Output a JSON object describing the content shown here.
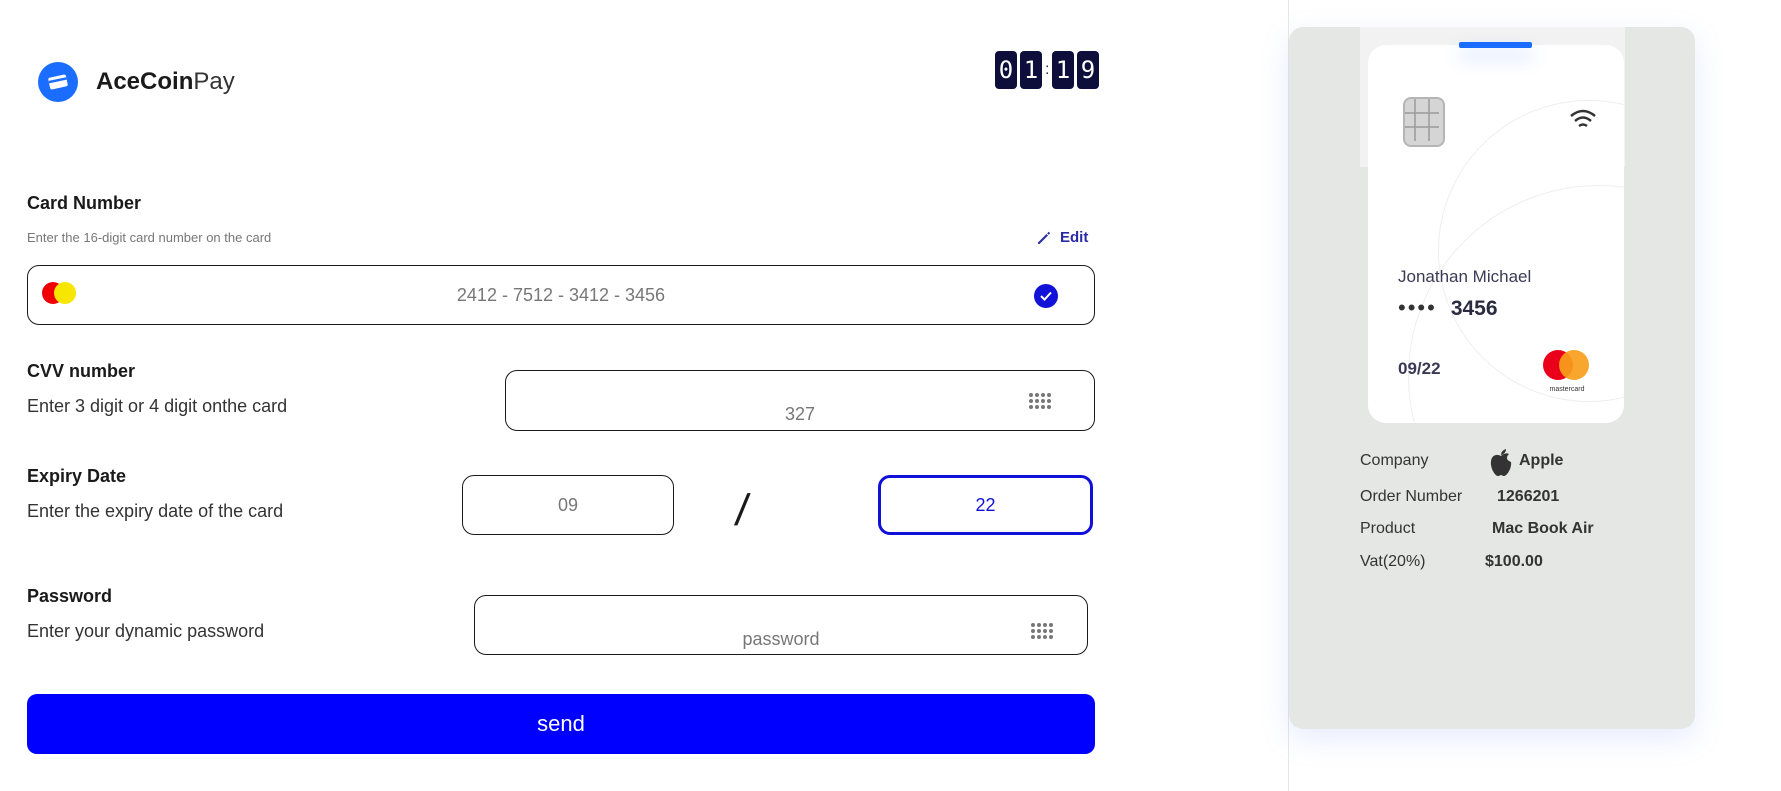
{
  "brand": {
    "bold": "AceCoin",
    "light": "Pay"
  },
  "timer": {
    "digits": [
      "0",
      "1",
      "1",
      "9"
    ],
    "separator": ":"
  },
  "card_number": {
    "label": "Card Number",
    "hint": "Enter the 16-digit card number on the card",
    "edit_label": "Edit",
    "value": "2412 - 7512 - 3412 - 3456"
  },
  "cvv": {
    "label": "CVV number",
    "hint": "Enter 3 digit or 4 digit onthe card",
    "value": "327"
  },
  "expiry": {
    "label": "Expiry Date",
    "hint": "Enter the expiry date of the card",
    "month": "09",
    "separator": "/",
    "year": "22"
  },
  "password": {
    "label": "Password",
    "hint": "Enter your dynamic password",
    "placeholder": "password"
  },
  "send_label": "send",
  "card_preview": {
    "holder": "Jonathan Michael",
    "masked": "••••",
    "last4": "3456",
    "expiry": "09/22",
    "network": "mastercard"
  },
  "order": {
    "company_label": "Company",
    "company_value": "Apple",
    "order_number_label": "Order Number",
    "order_number_value": "1266201",
    "product_label": "Product",
    "product_value": "Mac Book Air",
    "vat_label": "Vat(20%)",
    "vat_value": "$100.00"
  },
  "colors": {
    "accent": "#0000ff",
    "brand": "#1a6dff",
    "timer_bg": "#0d0f3a",
    "panel_bg": "#e4e7e4"
  }
}
